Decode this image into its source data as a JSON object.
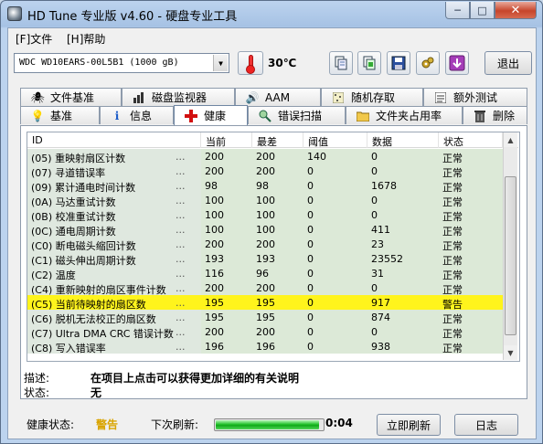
{
  "window": {
    "title": "HD Tune 专业版 v4.60 - 硬盘专业工具"
  },
  "menu": {
    "file": "[F]文件",
    "help": "[H]帮助"
  },
  "toolbar": {
    "drive": "WDC WD10EARS-00L5B1 (1000 gB)",
    "temperature": "30℃",
    "exit_label": "退出",
    "icons": [
      "copy-icon",
      "copy-green-icon",
      "save-icon",
      "settings-gears-icon",
      "download-icon"
    ]
  },
  "tabs_top": [
    {
      "label": "文件基准",
      "icon": "benchmark-icon"
    },
    {
      "label": "磁盘监视器",
      "icon": "disk-monitor-icon"
    },
    {
      "label": "AAM",
      "icon": "speaker-icon"
    },
    {
      "label": "随机存取",
      "icon": "random-access-icon"
    },
    {
      "label": "额外测试",
      "icon": "extra-tests-icon"
    }
  ],
  "tabs_bottom": [
    {
      "label": "基准",
      "icon": "lightbulb-icon"
    },
    {
      "label": "信息",
      "icon": "info-icon"
    },
    {
      "label": "健康",
      "icon": "health-cross-icon",
      "active": true
    },
    {
      "label": "错误扫描",
      "icon": "search-icon"
    },
    {
      "label": "文件夹占用率",
      "icon": "folder-icon"
    },
    {
      "label": "删除",
      "icon": "trash-icon"
    }
  ],
  "table": {
    "headers": [
      "ID",
      "当前",
      "最差",
      "阈值",
      "数据",
      "状态"
    ],
    "rows": [
      {
        "id": "(05) 重映射扇区计数",
        "cur": "200",
        "worst": "200",
        "thr": "140",
        "data": "0",
        "status": "正常"
      },
      {
        "id": "(07) 寻道错误率",
        "cur": "200",
        "worst": "200",
        "thr": "0",
        "data": "0",
        "status": "正常"
      },
      {
        "id": "(09) 累计通电时间计数",
        "cur": "98",
        "worst": "98",
        "thr": "0",
        "data": "1678",
        "status": "正常"
      },
      {
        "id": "(0A) 马达重试计数",
        "cur": "100",
        "worst": "100",
        "thr": "0",
        "data": "0",
        "status": "正常"
      },
      {
        "id": "(0B) 校准重试计数",
        "cur": "100",
        "worst": "100",
        "thr": "0",
        "data": "0",
        "status": "正常"
      },
      {
        "id": "(0C) 通电周期计数",
        "cur": "100",
        "worst": "100",
        "thr": "0",
        "data": "411",
        "status": "正常"
      },
      {
        "id": "(C0) 断电磁头缩回计数",
        "cur": "200",
        "worst": "200",
        "thr": "0",
        "data": "23",
        "status": "正常"
      },
      {
        "id": "(C1) 磁头伸出周期计数",
        "cur": "193",
        "worst": "193",
        "thr": "0",
        "data": "23552",
        "status": "正常"
      },
      {
        "id": "(C2) 温度",
        "cur": "116",
        "worst": "96",
        "thr": "0",
        "data": "31",
        "status": "正常"
      },
      {
        "id": "(C4) 重新映射的扇区事件计数",
        "cur": "200",
        "worst": "200",
        "thr": "0",
        "data": "0",
        "status": "正常"
      },
      {
        "id": "(C5) 当前待映射的扇区数",
        "cur": "195",
        "worst": "195",
        "thr": "0",
        "data": "917",
        "status": "警告",
        "warn": true
      },
      {
        "id": "(C6) 脱机无法校正的扇区数",
        "cur": "195",
        "worst": "195",
        "thr": "0",
        "data": "874",
        "status": "正常"
      },
      {
        "id": "(C7) Ultra DMA CRC 错误计数",
        "cur": "200",
        "worst": "200",
        "thr": "0",
        "data": "0",
        "status": "正常"
      },
      {
        "id": "(C8) 写入错误率",
        "cur": "196",
        "worst": "196",
        "thr": "0",
        "data": "938",
        "status": "正常"
      }
    ],
    "dots": "..."
  },
  "description": {
    "desc_label": "描述:",
    "desc_value": "在项目上点击可以获得更加详细的有关说明",
    "status_label": "状态:",
    "status_value": "无"
  },
  "footer": {
    "health_label": "健康状态:",
    "health_value": "警告",
    "health_color": "#d9a400",
    "next_refresh_label": "下次刷新:",
    "progress_fraction": 0.97,
    "countdown": "0:04",
    "refresh_button": "立即刷新",
    "log_button": "日志"
  }
}
